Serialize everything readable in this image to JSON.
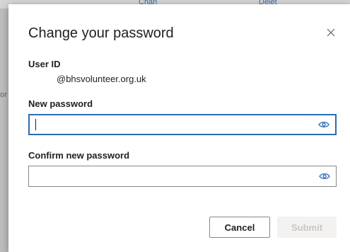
{
  "background": {
    "fragment_left": "Chan",
    "fragment_right": "Delet",
    "side_fragment": "or"
  },
  "dialog": {
    "title": "Change your password",
    "close_icon": "close-icon",
    "user_id": {
      "label": "User ID",
      "value": "@bhsvolunteer.org.uk"
    },
    "new_password": {
      "label": "New password",
      "value": "",
      "placeholder": "",
      "icon": "eye-icon"
    },
    "confirm_password": {
      "label": "Confirm new password",
      "value": "",
      "placeholder": "",
      "icon": "eye-icon"
    },
    "buttons": {
      "cancel": "Cancel",
      "submit": "Submit"
    }
  },
  "colors": {
    "accent": "#2b6cb6",
    "text": "#201f1e",
    "disabled_text": "#c8c6c4",
    "disabled_bg": "#f3f2f1"
  }
}
